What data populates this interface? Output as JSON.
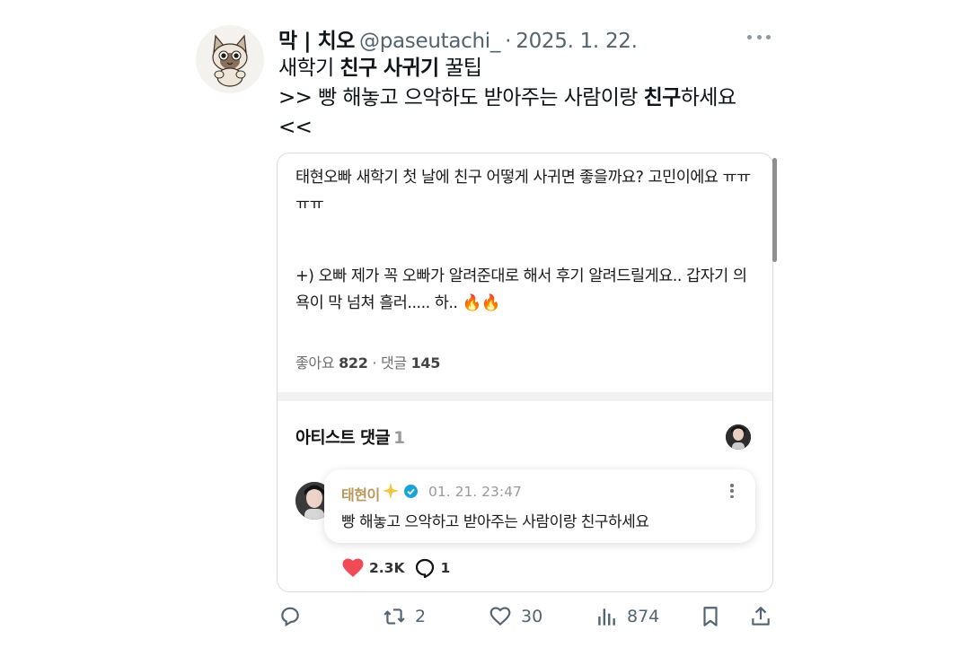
{
  "tweet": {
    "display_name": "막 | 치오",
    "handle": "@paseutachi_",
    "separator": "·",
    "date": "2025. 1. 22.",
    "text_line1_a": "새학기 ",
    "text_line1_bold": "친구 사귀기",
    "text_line1_b": " 꿀팁",
    "text_line2_a": ">> 빵 해놓고 으악하도 받아주는 사람이랑 ",
    "text_line2_bold": "친구",
    "text_line2_b": "하세요",
    "text_line3": "<<"
  },
  "card": {
    "post_p1": "태현오빠 새학기 첫 날에 친구 어떻게 사귀면 좋을까요? 고민이에요 ㅠㅠㅠㅠ",
    "post_p2": "+) 오빠 제가 꼭 오빠가 알려준대로 해서 후기 알려드릴게요.. 갑자기 의욕이 막 넘쳐 흘러..... 하.. 🔥🔥",
    "likes_label": "좋아요",
    "likes_count": "822",
    "stats_sep": "·",
    "comments_label": "댓글",
    "comments_count": "145",
    "artist_header": "아티스트 댓글",
    "artist_count": "1",
    "comment": {
      "name": "태현이",
      "time": "01. 21. 23:47",
      "text": "빵 해놓고 으악하고 받아주는 사람이랑 친구하세요",
      "likes": "2.3K",
      "replies": "1"
    }
  },
  "actions": {
    "retweets": "2",
    "likes": "30",
    "views": "874"
  },
  "colors": {
    "text": "#0f1419",
    "secondary": "#536471",
    "artist_name": "#b8975a",
    "heart": "#f04a58",
    "verified": "#1aa3d6"
  }
}
